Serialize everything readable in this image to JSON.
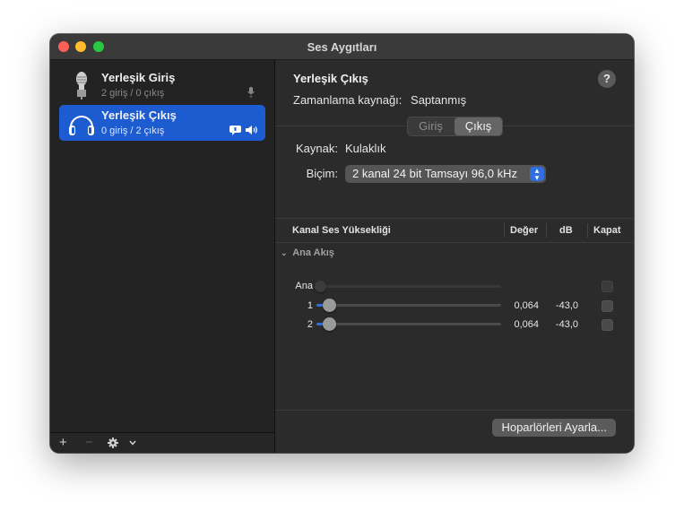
{
  "window": {
    "title": "Ses Aygıtları"
  },
  "sidebar": {
    "devices": [
      {
        "name": "Yerleşik Giriş",
        "io": "2 giriş / 0 çıkış",
        "icon": "microphone-icon",
        "badge": "small-mic-icon",
        "selected": false
      },
      {
        "name": "Yerleşik Çıkış",
        "io": "0 giriş / 2 çıkış",
        "icon": "headphones-icon",
        "badges": [
          "chat-bubble-icon",
          "speaker-icon"
        ],
        "selected": true
      }
    ],
    "footer": {
      "add": "+",
      "remove": "−",
      "gear_icon": "gear-icon",
      "chevron_icon": "chevron-down-icon"
    }
  },
  "main": {
    "title": "Yerleşik Çıkış",
    "help": "?",
    "clock_label": "Zamanlama kaynağı:",
    "clock_value": "Saptanmış",
    "tabs": {
      "input": "Giriş",
      "output": "Çıkış",
      "active": "Çıkış"
    },
    "source_label": "Kaynak:",
    "source_value": "Kulaklık",
    "format_label": "Biçim:",
    "format_value": "2 kanal 24 bit Tamsayı 96,0 kHz",
    "table": {
      "headers": {
        "channel": "Kanal Ses Yüksekliği",
        "value": "Değer",
        "db": "dB",
        "mute": "Kapat"
      },
      "group": "Ana Akış",
      "rows": [
        {
          "label": "Ana",
          "level": 0,
          "value": "",
          "db": "",
          "enabled": false
        },
        {
          "label": "1",
          "level": 0.064,
          "value": "0,064",
          "db": "-43,0",
          "enabled": true
        },
        {
          "label": "2",
          "level": 0.064,
          "value": "0,064",
          "db": "-43,0",
          "enabled": true
        }
      ]
    },
    "configure_button": "Hoparlörleri Ayarla..."
  },
  "colors": {
    "accent": "#2f6fe0",
    "selection": "#1d5bd1"
  }
}
